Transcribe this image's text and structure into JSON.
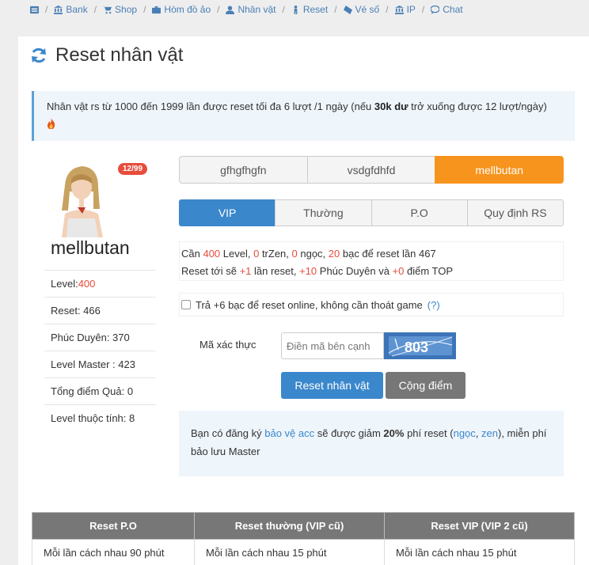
{
  "nav": {
    "items": [
      "Bank",
      "Shop",
      "Hòm đồ ảo",
      "Nhân vật",
      "Reset",
      "Vé số",
      "IP",
      "Chat"
    ]
  },
  "page": {
    "title": "Reset nhân vật"
  },
  "alert": {
    "text_before": "Nhân vật rs từ 1000 đến 1999 lần được reset tối đa 6 lượt /1 ngày (nếu ",
    "bold": "30k dư",
    "text_after": " trở xuống được 12 lượt/ngày)"
  },
  "character": {
    "name": "mellbutan",
    "badge": "12/99",
    "stats": {
      "level_label": "Level: ",
      "level_value": "400",
      "reset": "Reset: 466",
      "phuc_duyen": "Phúc Duyên: 370",
      "level_master": "Level Master : 423",
      "tong_diem_qua": "Tổng điểm Quả: 0",
      "level_thuoc_tinh": "Level thuộc tính: 8"
    }
  },
  "char_tabs": [
    "gfhgfhgfn",
    "vsdgfdhfd",
    "mellbutan"
  ],
  "mode_tabs": [
    "VIP",
    "Thường",
    "P.O",
    "Quy định RS"
  ],
  "requirements": {
    "line1": {
      "p1": "Cần ",
      "level": "400",
      "p2": " Level, ",
      "zen": "0",
      "p3": " trZen, ",
      "ngoc": "0",
      "p4": " ngọc, ",
      "bac": "20",
      "p5": " bạc để reset lần 467"
    },
    "line2": {
      "p1": "Reset tới sẽ ",
      "plus1": "+1",
      "p2": " lần reset, ",
      "plus10": "+10",
      "p3": " Phúc Duyên và ",
      "plus0": "+0",
      "p4": " điểm TOP"
    }
  },
  "online_option": {
    "label": "Trả +6 bạc để reset online, không cần thoát game",
    "help": "(?)"
  },
  "captcha": {
    "label": "Mã xác thực",
    "placeholder": "Điền mã bên cạnh",
    "code": "803"
  },
  "buttons": {
    "reset": "Reset nhân vật",
    "points": "Cộng điểm"
  },
  "note": {
    "p1": "Bạn có đăng ký ",
    "link1": "bảo vệ acc",
    "p2": " sẽ được giảm ",
    "bold": "20%",
    "p3": " phí reset (",
    "link2": "ngọc",
    "p4": ", ",
    "link3": "zen",
    "p5": "), miễn phí bảo lưu Master"
  },
  "table": {
    "headers": [
      "Reset P.O",
      "Reset thường (VIP cũ)",
      "Reset VIP (VIP 2 cũ)"
    ],
    "row1": [
      "Mỗi lần cách nhau 90 phút",
      "Mỗi lần cách nhau 15 phút",
      "Mỗi lần cách nhau 15 phút"
    ]
  }
}
